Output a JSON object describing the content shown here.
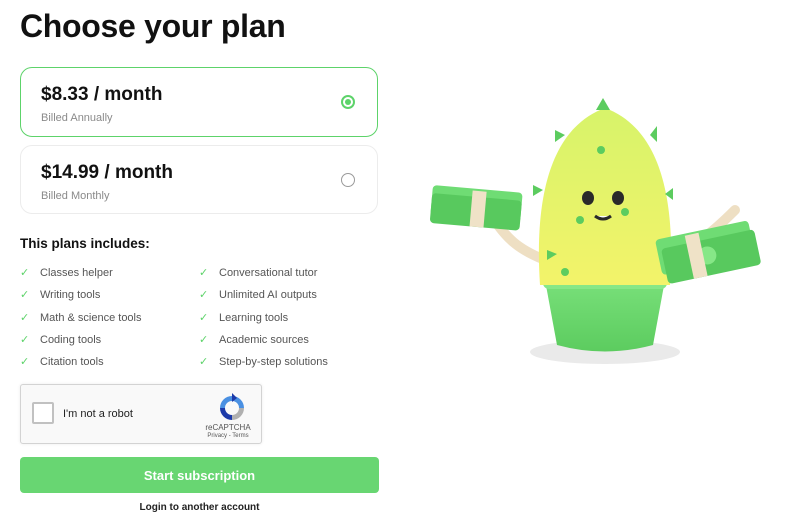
{
  "page": {
    "title": "Choose your plan"
  },
  "plans": [
    {
      "price": "$8.33 / month",
      "billing": "Billed Annually",
      "selected": true
    },
    {
      "price": "$14.99 / month",
      "billing": "Billed Monthly",
      "selected": false
    }
  ],
  "includes": {
    "title": "This plans includes:",
    "left": [
      "Classes helper",
      "Writing tools",
      "Math & science tools",
      "Coding tools",
      "Citation tools"
    ],
    "right": [
      "Conversational tutor",
      "Unlimited AI outputs",
      "Learning tools",
      "Academic sources",
      "Step-by-step solutions"
    ]
  },
  "captcha": {
    "label": "I'm not a robot",
    "brand": "reCAPTCHA",
    "links": "Privacy - Terms"
  },
  "actions": {
    "start_label": "Start subscription",
    "login_label": "Login to another account"
  },
  "colors": {
    "accent": "#68d672",
    "selected_border": "#5dd36a",
    "check": "#5dd36a"
  },
  "icons": [
    "check-icon",
    "recaptcha-icon",
    "cactus-mascot-illustration"
  ]
}
